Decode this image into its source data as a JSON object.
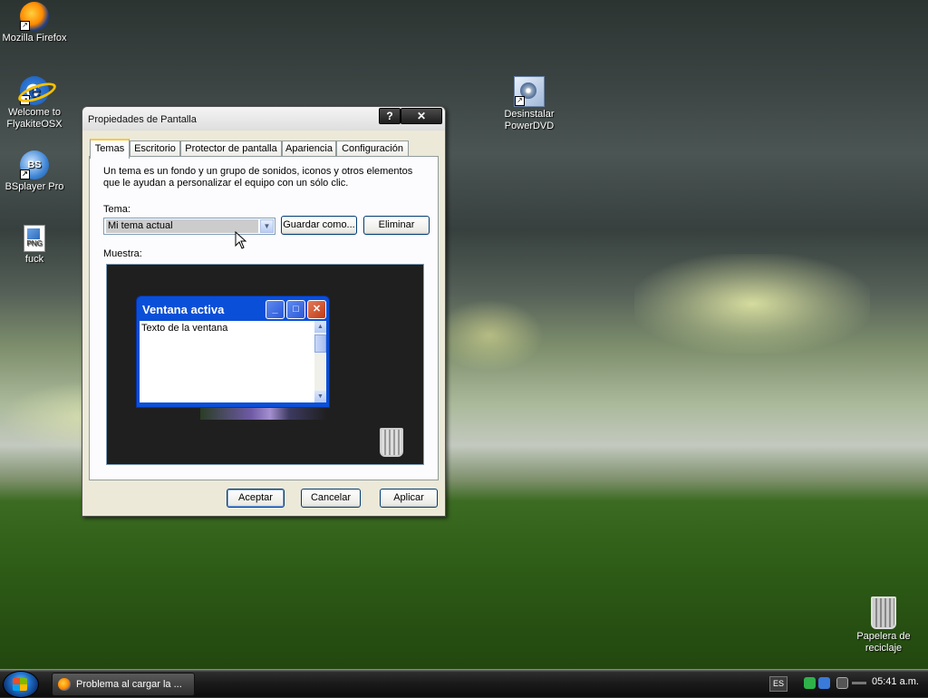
{
  "desktop": {
    "icons": [
      {
        "label": "Mozilla Firefox"
      },
      {
        "label": "Welcome to FlyakiteOSX"
      },
      {
        "label": "BSplayer Pro"
      },
      {
        "label": "fuck"
      },
      {
        "label": "Desinstalar PowerDVD"
      },
      {
        "label": "Papelera de reciclaje"
      }
    ]
  },
  "dialog": {
    "title": "Propiedades de Pantalla",
    "help_button": "?",
    "close_button": "✕",
    "tabs": [
      {
        "label": "Temas",
        "active": true
      },
      {
        "label": "Escritorio"
      },
      {
        "label": "Protector de pantalla"
      },
      {
        "label": "Apariencia"
      },
      {
        "label": "Configuración"
      }
    ],
    "description": "Un tema es un fondo y un grupo de sonidos, iconos y otros elementos que le ayudan a personalizar el equipo con un sólo clic.",
    "theme_label": "Tema:",
    "theme_value": "Mi tema actual",
    "save_as_button": "Guardar como...",
    "delete_button": "Eliminar",
    "sample_label": "Muestra:",
    "preview": {
      "window_title": "Ventana activa",
      "window_text": "Texto de la ventana"
    },
    "ok_button": "Aceptar",
    "cancel_button": "Cancelar",
    "apply_button": "Aplicar"
  },
  "taskbar": {
    "task_label": "Problema al cargar la ...",
    "language": "ES",
    "clock": "05:41 a.m."
  }
}
